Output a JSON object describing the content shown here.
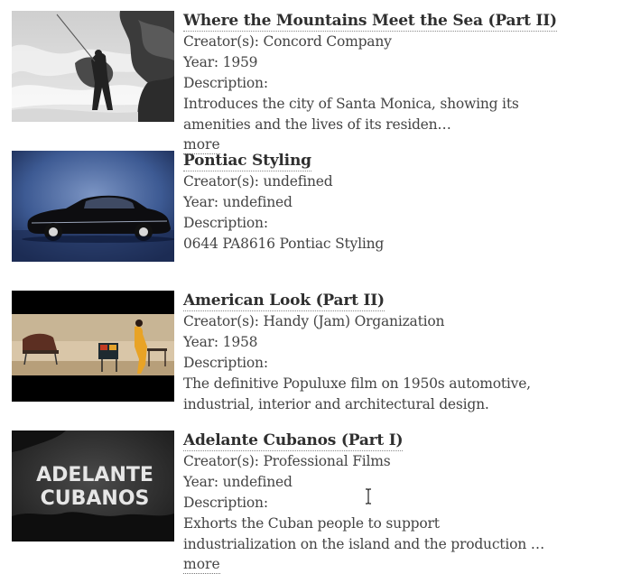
{
  "labels": {
    "creators": "Creator(s): ",
    "year": "Year: ",
    "description": "Description: ",
    "more": "more"
  },
  "results": [
    {
      "title": "Where the Mountains Meet the Sea (Part II)",
      "creators": "Concord Company",
      "year": "1959",
      "description_lines": [
        "Introduces the city of Santa Monica, showing its",
        "amenities and the lives of its residen…"
      ],
      "thumbnail": "black-and-white photo of a man fishing on coastal rocks with crashing waves"
    },
    {
      "title": "Pontiac Styling",
      "creators": "undefined",
      "year": "undefined",
      "description_lines": [
        "0644 PA8616 Pontiac Styling"
      ],
      "thumbnail": "vintage black car on a blue backdrop"
    },
    {
      "title": "American Look (Part II)",
      "creators": "Handy (Jam) Organization",
      "year": "1958",
      "description_lines": [
        "The definitive Populuxe film on 1950s automotive,",
        "industrial, interior and architectural design."
      ],
      "thumbnail": "woman in a mid-century modern interior with modern furniture"
    },
    {
      "title": "Adelante Cubanos (Part I)",
      "creators": "Professional Films",
      "year": "undefined",
      "description_lines": [
        "Exhorts the Cuban people to support",
        "industrialization on the island and the production …"
      ],
      "thumbnail_text": [
        "ADELANTE",
        "CUBANOS"
      ]
    }
  ]
}
